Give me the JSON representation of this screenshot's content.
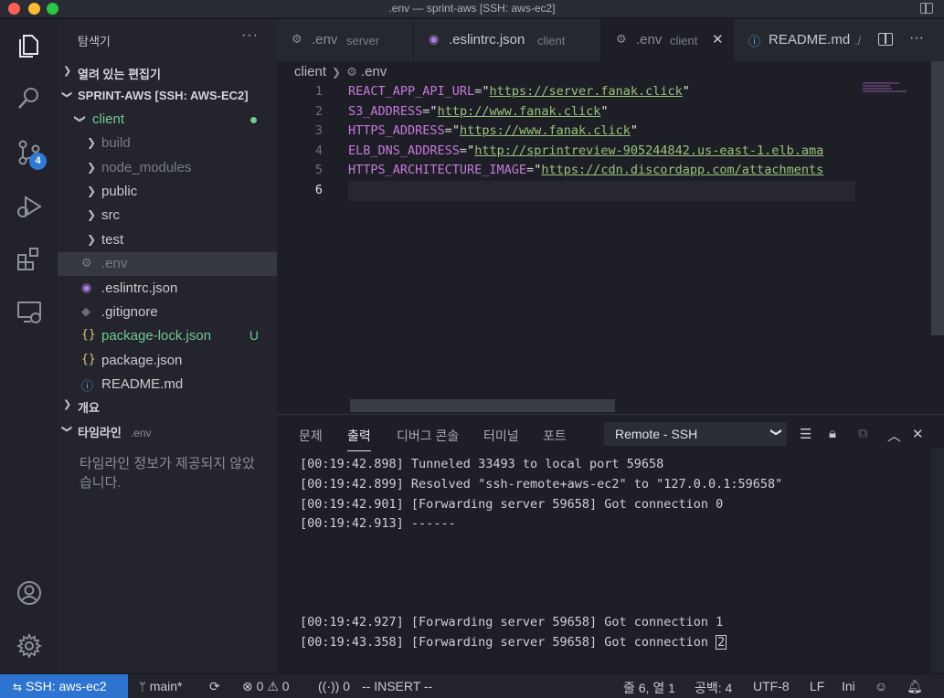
{
  "window": {
    "title": ".env — sprint-aws [SSH: aws-ec2]"
  },
  "activity_bar": {
    "source_control_badge": "4",
    "items": [
      "explorer-icon",
      "search-icon",
      "source-control-icon",
      "run-debug-icon",
      "extensions-icon",
      "remote-explorer-icon",
      "account-icon",
      "gear-icon"
    ]
  },
  "sidebar": {
    "header": "탐색기",
    "more": "···",
    "open_editors": "열려 있는 편집기",
    "workspace": "SPRINT-AWS [SSH: AWS-EC2]",
    "tree": [
      {
        "name": "client",
        "kind": "folder-open"
      },
      {
        "name": "build",
        "kind": "folder"
      },
      {
        "name": "node_modules",
        "kind": "folder"
      },
      {
        "name": "public",
        "kind": "folder"
      },
      {
        "name": "src",
        "kind": "folder"
      },
      {
        "name": "test",
        "kind": "folder"
      },
      {
        "name": ".env",
        "kind": "file"
      },
      {
        "name": ".eslintrc.json",
        "kind": "file"
      },
      {
        "name": ".gitignore",
        "kind": "file"
      },
      {
        "name": "package-lock.json",
        "kind": "file",
        "git": "U"
      },
      {
        "name": "package.json",
        "kind": "file"
      },
      {
        "name": "README.md",
        "kind": "file"
      }
    ],
    "outline": "개요",
    "timeline": "타임라인",
    "timeline_file": ".env",
    "timeline_message": "타임라인 정보가 제공되지 않았습니다."
  },
  "tabs": [
    {
      "name": ".env",
      "desc": "server"
    },
    {
      "name": ".eslintrc.json",
      "desc": "client"
    },
    {
      "name": ".env",
      "desc": "client",
      "close": "✕"
    },
    {
      "name": "README.md",
      "desc": "./"
    }
  ],
  "tab_actions": {
    "more": "···"
  },
  "breadcrumb": {
    "folder": "client",
    "file": ".env"
  },
  "editor": {
    "line_numbers": [
      "1",
      "2",
      "3",
      "4",
      "5",
      "6"
    ],
    "lines": [
      {
        "key": "REACT_APP_API_URL",
        "value": "https://server.fanak.click"
      },
      {
        "key": "S3_ADDRESS",
        "value": "http://www.fanak.click"
      },
      {
        "key": "HTTPS_ADDRESS",
        "value": "https://www.fanak.click"
      },
      {
        "key": "ELB_DNS_ADDRESS",
        "value": "http://sprintreview-905244842.us-east-1.elb.ama"
      },
      {
        "key": "HTTPS_ARCHITECTURE_IMAGE",
        "value": "https://cdn.discordapp.com/attachments"
      }
    ]
  },
  "panel": {
    "tabs": [
      "문제",
      "출력",
      "디버그 콘솔",
      "터미널",
      "포트"
    ],
    "active_tab": "출력",
    "channel": "Remote - SSH",
    "output": [
      "[00:19:42.898] Tunneled 33493 to local port 59658",
      "[00:19:42.899] Resolved \"ssh-remote+aws-ec2\" to \"127.0.0.1:59658\"",
      "[00:19:42.901] [Forwarding server 59658] Got connection 0",
      "[00:19:42.913] ------",
      "[00:19:42.927] [Forwarding server 59658] Got connection 1"
    ],
    "last_line_prefix": "[00:19:43.358] [Forwarding server 59658] Got connection ",
    "last_line_cursor": "2"
  },
  "statusbar": {
    "remote": "SSH: aws-ec2",
    "branch": "main*",
    "errors": "0",
    "warnings": "0",
    "ports": "0",
    "mode": "-- INSERT --",
    "position": "줄 6, 열 1",
    "spaces": "공백: 4",
    "encoding": "UTF-8",
    "eol": "LF",
    "language": "Ini"
  },
  "colors": {
    "accent": "#2d74d0",
    "git_untracked": "#73c991",
    "string": "#98c379",
    "env_key": "#c678dd",
    "badge": "#2f7ad6"
  }
}
